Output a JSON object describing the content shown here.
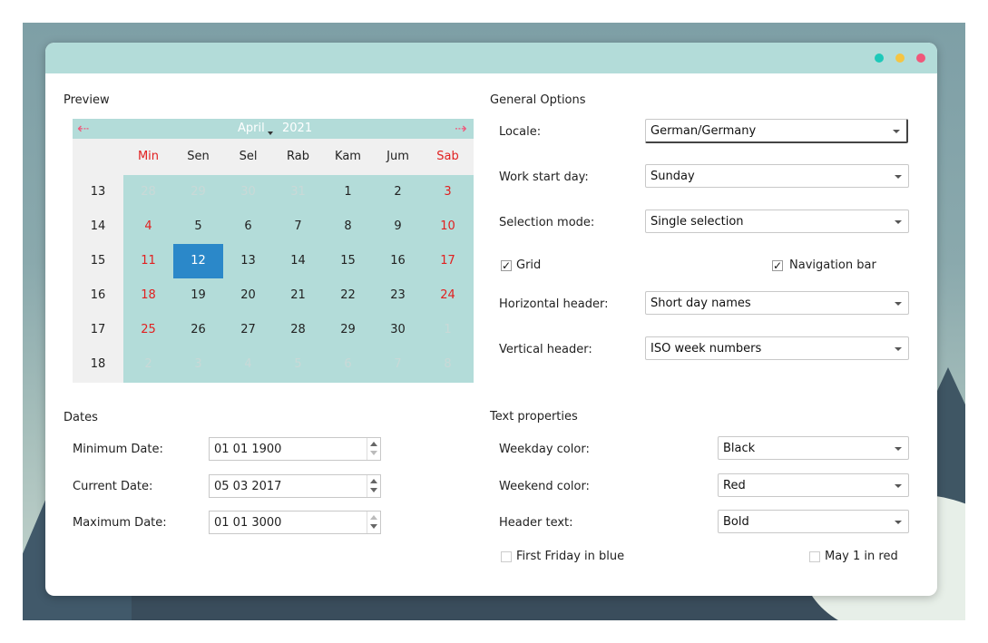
{
  "window": {
    "controls": [
      "minimize",
      "maximize",
      "close"
    ]
  },
  "preview": {
    "title": "Preview",
    "calendar": {
      "month": "April",
      "year": "2021",
      "prev_icon": "arrow-left-icon",
      "next_icon": "arrow-right-icon",
      "day_headers": [
        "Min",
        "Sen",
        "Sel",
        "Rab",
        "Kam",
        "Jum",
        "Sab"
      ],
      "week_numbers": [
        "13",
        "14",
        "15",
        "16",
        "17",
        "18"
      ],
      "weeks": [
        [
          "28",
          "29",
          "30",
          "31",
          "1",
          "2",
          "3"
        ],
        [
          "4",
          "5",
          "6",
          "7",
          "8",
          "9",
          "10"
        ],
        [
          "11",
          "12",
          "13",
          "14",
          "15",
          "16",
          "17"
        ],
        [
          "18",
          "19",
          "20",
          "21",
          "22",
          "23",
          "24"
        ],
        [
          "25",
          "26",
          "27",
          "28",
          "29",
          "30",
          "1"
        ],
        [
          "2",
          "3",
          "4",
          "5",
          "6",
          "7",
          "8"
        ]
      ],
      "selected_day": "12",
      "colors": {
        "weekend": "#e12020",
        "selection": "#2b88c9",
        "accent": "#b3dcd9",
        "nav_arrows": "#f0577a"
      }
    }
  },
  "general": {
    "title": "General Options",
    "locale": {
      "label": "Locale:",
      "value": "German/Germany"
    },
    "work_start": {
      "label": "Work start day:",
      "value": "Sunday"
    },
    "selection_mode": {
      "label": "Selection mode:",
      "value": "Single selection"
    },
    "grid": {
      "label": "Grid",
      "checked": true
    },
    "navigation_bar": {
      "label": "Navigation bar",
      "checked": true
    },
    "horizontal_header": {
      "label": "Horizontal header:",
      "value": "Short day names"
    },
    "vertical_header": {
      "label": "Vertical header:",
      "value": "ISO week numbers"
    }
  },
  "dates": {
    "title": "Dates",
    "minimum": {
      "label": "Minimum Date:",
      "value": "01 01 1900"
    },
    "current": {
      "label": "Current Date:",
      "value": "05 03 2017"
    },
    "maximum": {
      "label": "Maximum Date:",
      "value": "01 01 3000"
    }
  },
  "text_props": {
    "title": "Text properties",
    "weekday_color": {
      "label": "Weekday color:",
      "value": "Black"
    },
    "weekend_color": {
      "label": "Weekend color:",
      "value": "Red"
    },
    "header_text": {
      "label": "Header text:",
      "value": "Bold"
    },
    "first_friday": {
      "label": "First Friday in blue",
      "checked": false
    },
    "may_first": {
      "label": "May 1 in red",
      "checked": false
    }
  }
}
